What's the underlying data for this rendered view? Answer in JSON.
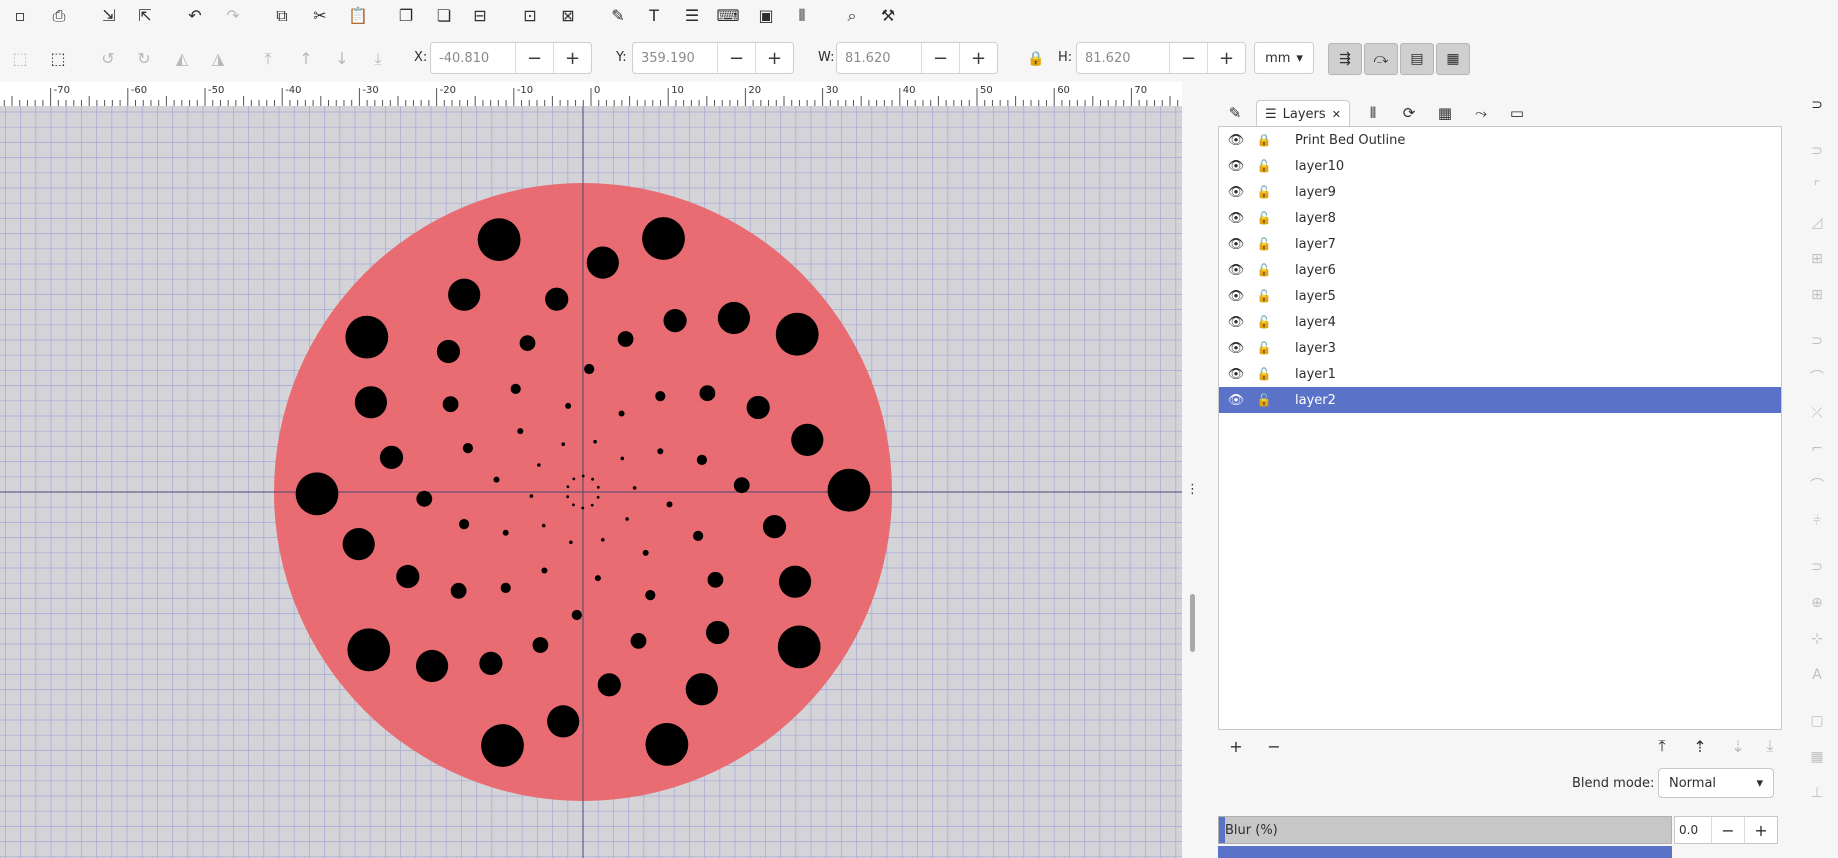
{
  "toolbar": {
    "icons": [
      "new-document-icon",
      "print-icon",
      "import-icon",
      "export-icon",
      "undo-icon",
      "redo-icon",
      "copy-icon",
      "cut-icon",
      "paste-icon",
      "duplicate-icon",
      "clone-icon",
      "unlink-clone-icon",
      "group-icon",
      "ungroup-icon",
      "xml-editor-icon",
      "text-icon",
      "layers-icon",
      "objects-icon",
      "symbols-icon",
      "align-icon",
      "find-icon",
      "preferences-icon"
    ]
  },
  "transform": {
    "x_label": "X:",
    "x_value": "-40.810",
    "y_label": "Y:",
    "y_value": "359.190",
    "w_label": "W:",
    "w_value": "81.620",
    "h_label": "H:",
    "h_value": "81.620",
    "unit": "mm",
    "minus": "−",
    "plus": "+"
  },
  "ruler": {
    "ticks": [
      "-70",
      "-60",
      "-50",
      "-40",
      "-30",
      "-20",
      "-10",
      "0",
      "10",
      "20",
      "30",
      "40",
      "50",
      "60",
      "70"
    ]
  },
  "panel": {
    "tab_label": "Layers",
    "tab_close": "✕",
    "layers": [
      {
        "name": "Print Bed Outline",
        "locked": true,
        "selected": false
      },
      {
        "name": "layer10",
        "locked": false,
        "selected": false
      },
      {
        "name": "layer9",
        "locked": false,
        "selected": false
      },
      {
        "name": "layer8",
        "locked": false,
        "selected": false
      },
      {
        "name": "layer7",
        "locked": false,
        "selected": false
      },
      {
        "name": "layer6",
        "locked": false,
        "selected": false
      },
      {
        "name": "layer5",
        "locked": false,
        "selected": false
      },
      {
        "name": "layer4",
        "locked": false,
        "selected": false
      },
      {
        "name": "layer3",
        "locked": false,
        "selected": false
      },
      {
        "name": "layer1",
        "locked": false,
        "selected": false
      },
      {
        "name": "layer2",
        "locked": false,
        "selected": true
      }
    ],
    "add": "+",
    "remove": "−",
    "blend_label": "Blend mode:",
    "blend_value": "Normal",
    "blur_label": "Blur (%)",
    "blur_value": "0.0",
    "blur_minus": "−",
    "blur_plus": "+"
  },
  "colors": {
    "accent": "#5a72c8",
    "bed": "#e96468",
    "dots": "#000000"
  }
}
